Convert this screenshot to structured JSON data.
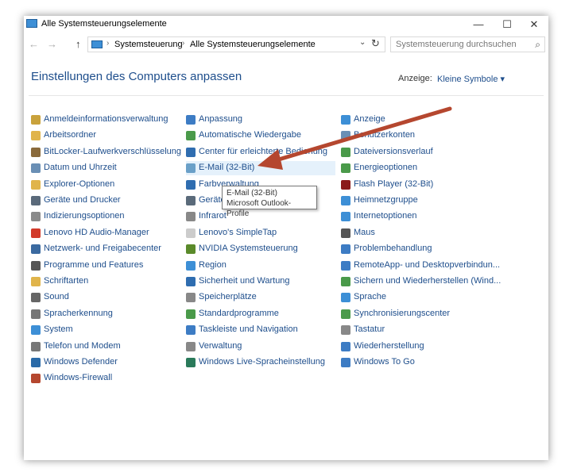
{
  "window": {
    "title": "Alle Systemsteuerungselemente",
    "controls": {
      "minimize": "—",
      "maximize": "☐",
      "close": "✕"
    }
  },
  "address": {
    "back": "←",
    "forward": "→",
    "up": "↑",
    "sep": "›",
    "segments": [
      "Systemsteuerung",
      "Alle Systemsteuerungselemente"
    ],
    "dropdown": "⌄",
    "refresh": "↻"
  },
  "search": {
    "placeholder": "Systemsteuerung durchsuchen",
    "icon": "⌕"
  },
  "header": {
    "title": "Einstellungen des Computers anpassen",
    "view_label": "Anzeige:",
    "view_value": "Kleine Symbole ▾"
  },
  "colors": {
    "link": "#1e4e8c",
    "arrow": "#b5472f",
    "highlight": "#e5f1fb"
  },
  "columns": [
    [
      {
        "label": "Anmeldeinformationsverwaltung",
        "icon": "credential-icon",
        "color": "#c9a23c"
      },
      {
        "label": "Arbeitsordner",
        "icon": "folder-icon",
        "color": "#e0b44b"
      },
      {
        "label": "BitLocker-Laufwerkverschlüsselung",
        "icon": "bitlocker-icon",
        "color": "#8a6a3b"
      },
      {
        "label": "Datum und Uhrzeit",
        "icon": "clock-icon",
        "color": "#6a8fb5"
      },
      {
        "label": "Explorer-Optionen",
        "icon": "explorer-options-icon",
        "color": "#e0b44b"
      },
      {
        "label": "Geräte und Drucker",
        "icon": "printer-icon",
        "color": "#5a6a7a"
      },
      {
        "label": "Indizierungsoptionen",
        "icon": "indexing-icon",
        "color": "#8a8a8a"
      },
      {
        "label": "Lenovo HD Audio-Manager",
        "icon": "audio-manager-icon",
        "color": "#d23a2a"
      },
      {
        "label": "Netzwerk- und Freigabecenter",
        "icon": "network-icon",
        "color": "#3b6aa0"
      },
      {
        "label": "Programme und Features",
        "icon": "programs-icon",
        "color": "#555555"
      },
      {
        "label": "Schriftarten",
        "icon": "fonts-icon",
        "color": "#e0b44b"
      },
      {
        "label": "Sound",
        "icon": "speaker-icon",
        "color": "#666666"
      },
      {
        "label": "Spracherkennung",
        "icon": "microphone-icon",
        "color": "#777777"
      },
      {
        "label": "System",
        "icon": "system-icon",
        "color": "#3d8fd6"
      },
      {
        "label": "Telefon und Modem",
        "icon": "phone-icon",
        "color": "#777777"
      },
      {
        "label": "Windows Defender",
        "icon": "defender-icon",
        "color": "#2a6aa8"
      },
      {
        "label": "Windows-Firewall",
        "icon": "firewall-icon",
        "color": "#b5472f"
      }
    ],
    [
      {
        "label": "Anpassung",
        "icon": "personalization-icon",
        "color": "#3d7cc4"
      },
      {
        "label": "Automatische Wiedergabe",
        "icon": "autoplay-icon",
        "color": "#4a9a4a"
      },
      {
        "label": "Center für erleichterte Bedienung",
        "icon": "accessibility-icon",
        "color": "#2f6db0"
      },
      {
        "label": "E-Mail (32-Bit)",
        "icon": "mail-icon",
        "color": "#6aa0c8"
      },
      {
        "label": "Farbverwaltung",
        "icon": "color-management-icon",
        "color": "#2f6db0"
      },
      {
        "label": "Geräte-Manager",
        "icon": "device-manager-icon",
        "color": "#5a6a7a"
      },
      {
        "label": "Infrarot",
        "icon": "infrared-icon",
        "color": "#888888"
      },
      {
        "label": "Lenovo's SimpleTap",
        "icon": "simpletap-icon",
        "color": "#cccccc"
      },
      {
        "label": "NVIDIA Systemsteuerung",
        "icon": "nvidia-icon",
        "color": "#5a8a2a"
      },
      {
        "label": "Region",
        "icon": "region-icon",
        "color": "#3d8fd6"
      },
      {
        "label": "Sicherheit und Wartung",
        "icon": "flag-icon",
        "color": "#2f6db0"
      },
      {
        "label": "Speicherplätze",
        "icon": "storage-icon",
        "color": "#888888"
      },
      {
        "label": "Standardprogramme",
        "icon": "default-programs-icon",
        "color": "#4a9a4a"
      },
      {
        "label": "Taskleiste und Navigation",
        "icon": "taskbar-icon",
        "color": "#3d7cc4"
      },
      {
        "label": "Verwaltung",
        "icon": "admin-tools-icon",
        "color": "#888888"
      },
      {
        "label": "Windows Live-Spracheinstellung",
        "icon": "globe-icon",
        "color": "#2a7a5a"
      }
    ],
    [
      {
        "label": "Anzeige",
        "icon": "display-icon",
        "color": "#3d8fd6"
      },
      {
        "label": "Benutzerkonten",
        "icon": "user-accounts-icon",
        "color": "#6a8fb5"
      },
      {
        "label": "Dateiversionsverlauf",
        "icon": "file-history-icon",
        "color": "#4a9a4a"
      },
      {
        "label": "Energieoptionen",
        "icon": "power-icon",
        "color": "#4a9a4a"
      },
      {
        "label": "Flash Player (32-Bit)",
        "icon": "flash-icon",
        "color": "#8a1a1a"
      },
      {
        "label": "Heimnetzgruppe",
        "icon": "homegroup-icon",
        "color": "#3d8fd6"
      },
      {
        "label": "Internetoptionen",
        "icon": "internet-options-icon",
        "color": "#3d8fd6"
      },
      {
        "label": "Maus",
        "icon": "mouse-icon",
        "color": "#555555"
      },
      {
        "label": "Problembehandlung",
        "icon": "troubleshoot-icon",
        "color": "#3d7cc4"
      },
      {
        "label": "RemoteApp- und Desktopverbindun...",
        "icon": "remoteapp-icon",
        "color": "#3d7cc4"
      },
      {
        "label": "Sichern und Wiederherstellen (Wind...",
        "icon": "backup-icon",
        "color": "#4a9a4a"
      },
      {
        "label": "Sprache",
        "icon": "language-icon",
        "color": "#3d8fd6"
      },
      {
        "label": "Synchronisierungscenter",
        "icon": "sync-icon",
        "color": "#4a9a4a"
      },
      {
        "label": "Tastatur",
        "icon": "keyboard-icon",
        "color": "#888888"
      },
      {
        "label": "Wiederherstellung",
        "icon": "recovery-icon",
        "color": "#3d7cc4"
      },
      {
        "label": "Windows To Go",
        "icon": "windows-to-go-icon",
        "color": "#3d7cc4"
      }
    ]
  ],
  "tooltip": {
    "line1": "E-Mail (32-Bit)",
    "line2": "Microsoft Outlook-Profile"
  }
}
